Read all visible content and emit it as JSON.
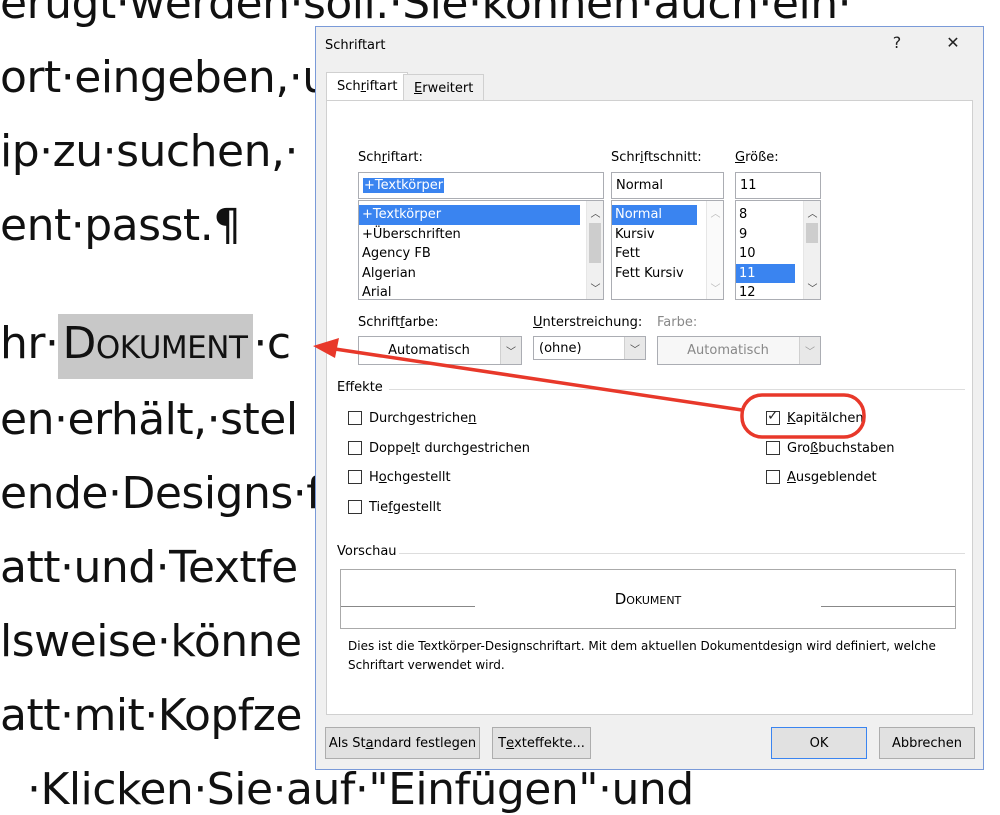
{
  "background": {
    "lines": [
      "erugt·werden·soll.·Sie·können·auch·ein·",
      "ort·eingeben,·u",
      "ip·zu·suchen,·",
      "ent·passt.¶",
      "",
      "en·erhält,·stel",
      "ende·Designs·f",
      "att·und·Textfe",
      "lsweise·könne",
      "att·mit·Kopfze",
      "  ·Klicken·Sie·auf·\"Einfügen\"·und"
    ],
    "line5_prefix": "hr·",
    "line5_highlight": "Dokument",
    "line5_suffix": "·c"
  },
  "dialog": {
    "title": "Schriftart",
    "help_glyph": "?",
    "close_glyph": "✕",
    "tabs": [
      {
        "pre": "Sch",
        "u": "r",
        "post": "iftart"
      },
      {
        "pre": "",
        "u": "E",
        "post": "rweitert"
      }
    ],
    "font_label": {
      "pre": "Sch",
      "u": "r",
      "post": "iftart:"
    },
    "font_value": "+Textkörper",
    "font_list": [
      "+Textkörper",
      "+Überschriften",
      "Agency FB",
      "Algerian",
      "Arial"
    ],
    "style_label": {
      "pre": "Schr",
      "u": "i",
      "post": "ftschnitt:"
    },
    "style_value": "Normal",
    "style_list": [
      "Normal",
      "Kursiv",
      "Fett",
      "Fett Kursiv"
    ],
    "size_label": {
      "pre": "",
      "u": "G",
      "post": "röße:"
    },
    "size_value": "11",
    "size_list": [
      "8",
      "9",
      "10",
      "11",
      "12"
    ],
    "color_label": {
      "pre": "Schrift",
      "u": "f",
      "post": "arbe:"
    },
    "color_value": "Automatisch",
    "underline_label": {
      "pre": "",
      "u": "U",
      "post": "nterstreichung:"
    },
    "underline_value": "(ohne)",
    "ucolor_label": "Farbe:",
    "ucolor_value": "Automatisch",
    "effects_title": "Effekte",
    "effects_left": [
      {
        "pre": "Durchgestriche",
        "u": "n",
        "post": "",
        "checked": false
      },
      {
        "pre": "Doppe",
        "u": "l",
        "post": "t durchgestrichen",
        "checked": false
      },
      {
        "pre": "H",
        "u": "o",
        "post": "chgestellt",
        "checked": false
      },
      {
        "pre": "Tie",
        "u": "f",
        "post": "gestellt",
        "checked": false
      }
    ],
    "effects_right": [
      {
        "pre": "",
        "u": "K",
        "post": "apitälchen",
        "checked": true
      },
      {
        "pre": "Gro",
        "u": "ß",
        "post": "buchstaben",
        "checked": false
      },
      {
        "pre": "",
        "u": "A",
        "post": "usgeblendet",
        "checked": false
      }
    ],
    "preview_title": "Vorschau",
    "preview_text": "Dokument",
    "description": "Dies ist die Textkörper-Designschriftart. Mit dem aktuellen Dokumentdesign wird definiert, welche Schriftart verwendet wird.",
    "buttons": {
      "set_default": {
        "pre": "Als St",
        "u": "a",
        "post": "ndard festlegen"
      },
      "text_effects": {
        "pre": "T",
        "u": "e",
        "post": "xteffekte..."
      },
      "ok": "OK",
      "cancel": "Abbrechen"
    }
  },
  "colors": {
    "annotation": "#e8382a",
    "selection": "#3a84f0",
    "highlight": "#c8c8c8"
  }
}
